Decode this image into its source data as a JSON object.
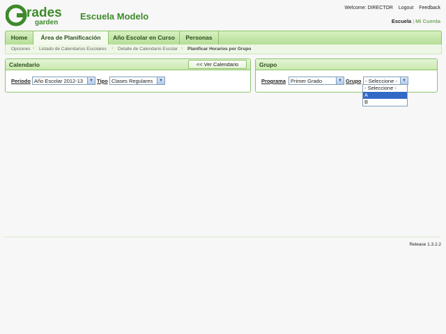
{
  "header": {
    "logo_text_main": "rades",
    "logo_text_sub": "garden",
    "school_name": "Escuela Modelo",
    "welcome": "Welcome: DIRECTOR",
    "logout": "Logout",
    "feedback": "Feedback",
    "account_active": "Escuela",
    "account_inactive": "Mi Cuenta",
    "brand_color": "#3d8a2a"
  },
  "nav": {
    "tabs": [
      {
        "label": "Home"
      },
      {
        "label": "Área de Planificación"
      },
      {
        "label": "Año Escolar en Curso"
      },
      {
        "label": "Personas"
      }
    ]
  },
  "breadcrumb": {
    "items": [
      "Opciones",
      "Listado de Calendarios Escolares",
      "Detalle de Calendario Escolar",
      "Planificar Horarios por Grupo"
    ]
  },
  "calendario": {
    "title": "Calendario",
    "button": "<< Ver Calendario",
    "periodo_label": "Periodo",
    "periodo_value": "Año Escolar 2012-13",
    "tipo_label": "Tipo",
    "tipo_value": "Clases Regulares"
  },
  "grupo": {
    "title": "Grupo",
    "programa_label": "Programa",
    "programa_value": "Primer Grado",
    "grupo_label": "Grupo",
    "grupo_value": "- Seleccione -",
    "options": [
      "- Seleccione -",
      "A",
      "B"
    ],
    "highlighted": "A"
  },
  "footer": {
    "release": "Release 1.3.2.2"
  }
}
